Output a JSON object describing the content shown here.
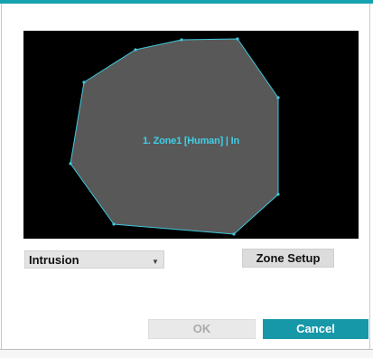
{
  "dialog": {
    "zone": {
      "label": "1. Zone1 [Human] | In",
      "fill_color": "#585858",
      "outline_color": "#3fc8dc"
    },
    "event_type": {
      "selected": "Intrusion"
    },
    "buttons": {
      "zone_setup": "Zone Setup",
      "ok": "OK",
      "cancel": "Cancel"
    },
    "colors": {
      "accent": "#17a2b1",
      "cancel_bg": "#1798a9",
      "disabled_text": "#a9a9a9"
    }
  }
}
